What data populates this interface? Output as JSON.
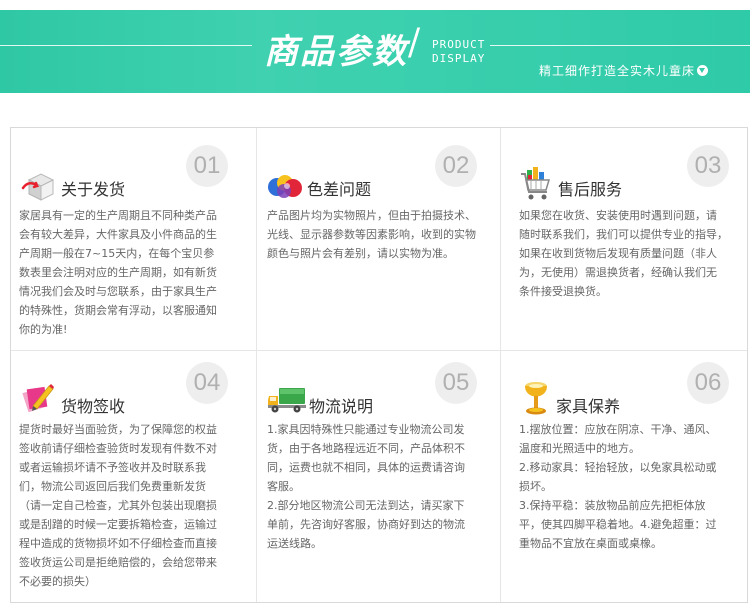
{
  "header": {
    "title": "商品参数",
    "slash": "/",
    "subtitle_line1": "PRODUCT",
    "subtitle_line2": "DISPLAY",
    "slogan": "精工细作打造全实木儿童床"
  },
  "colors": {
    "banner": "#3fd1b0",
    "number_circle": "#eeeeee",
    "number_text": "#b0b0b0",
    "title_text": "#333333",
    "body_text": "#666666"
  },
  "sections": [
    {
      "number": "01",
      "title": "关于发货",
      "icon": "shipping-box-icon",
      "lines": [
        "家居具有一定的生产周期且不同种类产品",
        "会有较大差异，大件家具及小件商品的生",
        "产周期一般在7~15天内，在每个宝贝参",
        "数表里会注明对应的生产周期，如有新货",
        "情况我们会及时与您联系，由于家具生产",
        "的特殊性，货期会常有浮动，以客服通知",
        "你的为准!"
      ]
    },
    {
      "number": "02",
      "title": "色差问题",
      "icon": "color-palette-icon",
      "lines": [
        "产品图片均为实物照片，但由于拍摄技术、",
        "光线、显示器参数等因素影响，收到的实物",
        "颜色与照片会有差别，请以实物为准。"
      ]
    },
    {
      "number": "03",
      "title": "售后服务",
      "icon": "shopping-cart-icon",
      "lines": [
        "如果您在收货、安装使用时遇到问题，请",
        "随时联系我们，我们可以提供专业的指导，",
        "如果在收到货物后发现有质量问题（非人",
        "为，无使用）需退换货者，经确认我们无",
        "条件接受退换货。"
      ]
    },
    {
      "number": "04",
      "title": "货物签收",
      "icon": "sign-pencil-icon",
      "lines": [
        "提货时最好当面验货，为了保障您的权益",
        "签收前请仔细检查验货时发现有件数不对",
        "或者运输损坏请不予签收并及时联系我",
        "们，物流公司返回后我们免费重新发货",
        "（请一定自己检查，尤其外包装出现磨损",
        "或是刮蹭的时候一定要拆箱检查，运输过",
        "程中造成的货物损坏如不仔细检查而直接",
        "签收货运公司是拒绝赔偿的，会给您带来",
        "不必要的损失）"
      ]
    },
    {
      "number": "05",
      "title": "物流说明",
      "icon": "delivery-truck-icon",
      "lines": [
        "1.家具因特殊性只能通过专业物流公司发",
        "货，由于各地路程远近不同，产品体积不",
        "同，运费也就不相同，具体的运费请咨询",
        "客服。",
        "2.部分地区物流公司无法到达，请买家下",
        "单前，先咨询好客服，协商好到达的物流",
        "运送线路。"
      ]
    },
    {
      "number": "06",
      "title": "家具保养",
      "icon": "lamp-icon",
      "lines": [
        "1.摆放位置：应放在阴凉、干净、通风、",
        "温度和光照适中的地方。",
        "2.移动家具：轻抬轻放，以免家具松动或",
        "损坏。",
        "3.保持平稳：装放物品前应先把柜体放",
        "平，使其四脚平稳着地。4.避免超重：过",
        "重物品不宜放在桌面或桌橡。"
      ]
    }
  ]
}
